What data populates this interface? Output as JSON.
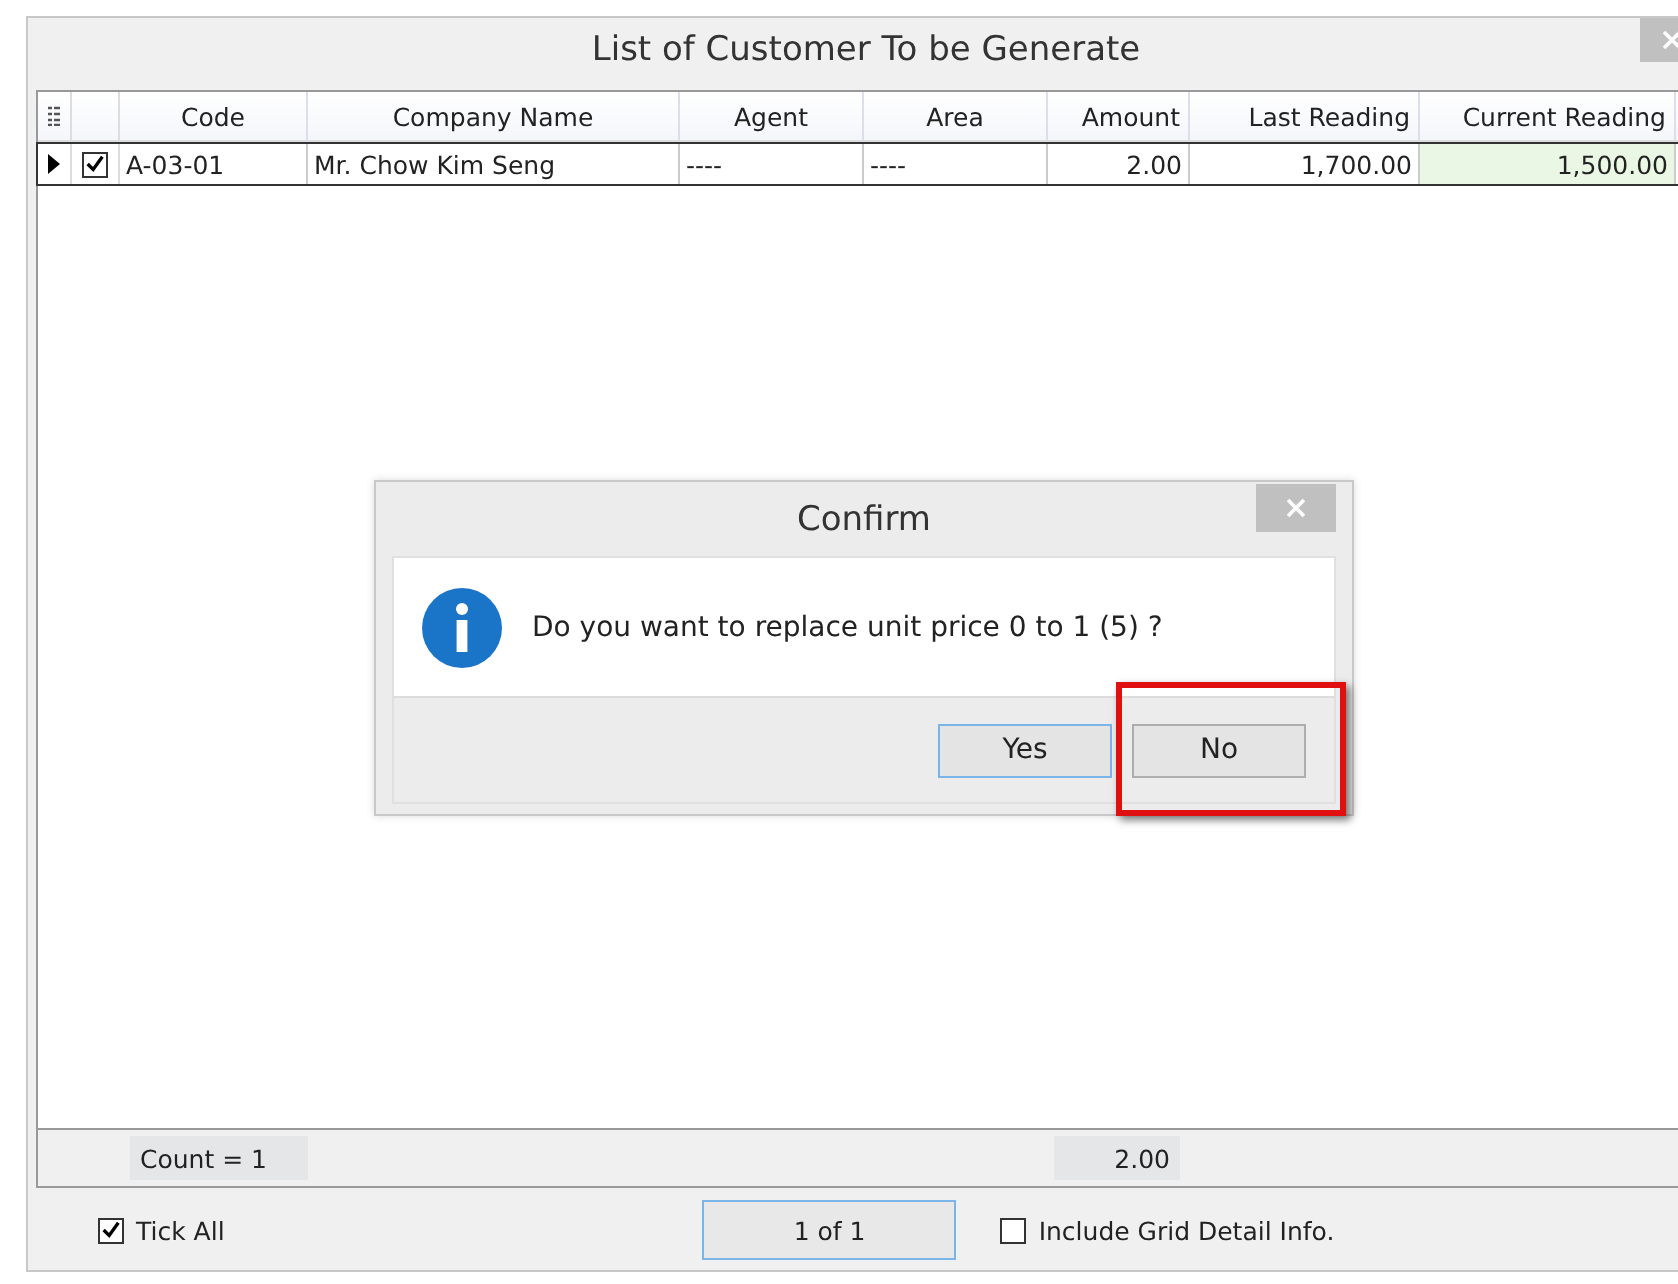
{
  "window": {
    "title": "List of Customer To be Generate"
  },
  "grid": {
    "columns": [
      {
        "label": "Code",
        "kind": "text",
        "highlighted": false
      },
      {
        "label": "Company Name",
        "kind": "text",
        "highlighted": false
      },
      {
        "label": "Agent",
        "kind": "text",
        "highlighted": false
      },
      {
        "label": "Area",
        "kind": "text",
        "highlighted": false
      },
      {
        "label": "Amount",
        "kind": "number",
        "highlighted": false
      },
      {
        "label": "Last Reading",
        "kind": "number",
        "highlighted": false
      },
      {
        "label": "Current Reading",
        "kind": "number",
        "highlighted": true
      }
    ],
    "rows": [
      {
        "selected": true,
        "checked": true,
        "cells": [
          "A-03-01",
          "Mr. Chow Kim Seng",
          "----",
          "----",
          "2.00",
          "1,700.00",
          "1,500.00"
        ]
      }
    ],
    "footer": {
      "count": "Count = 1",
      "total": "2.00"
    }
  },
  "options": {
    "tick_all": {
      "label": "Tick All",
      "checked": true
    },
    "pager": "1 of 1",
    "include_detail": {
      "label": "Include Grid Detail Info.",
      "checked": false
    }
  },
  "dialog": {
    "title": "Confirm",
    "message": "Do you want to replace unit price 0 to 1 (5) ?",
    "buttons": [
      {
        "label": "Yes",
        "default": true,
        "highlighted": false
      },
      {
        "label": "No",
        "default": false,
        "highlighted": true
      }
    ]
  }
}
